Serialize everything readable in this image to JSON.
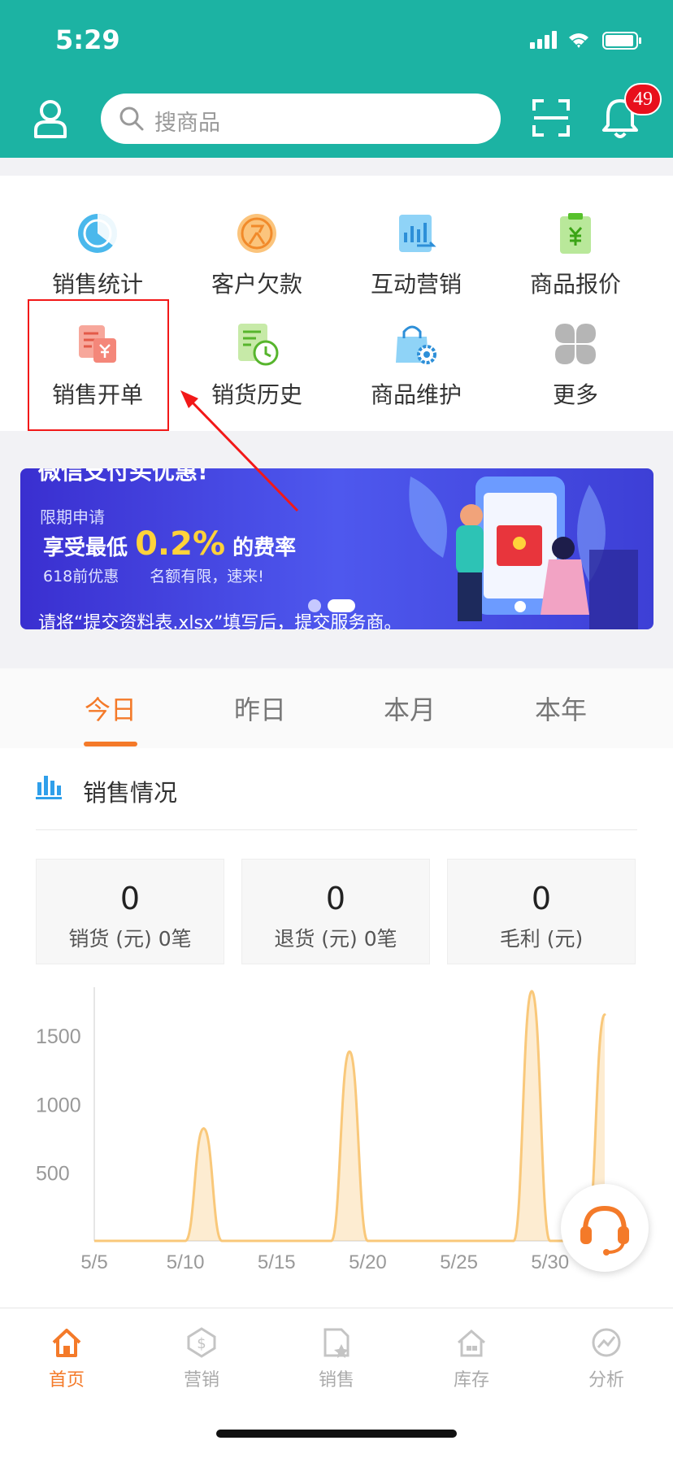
{
  "status_bar": {
    "time": "5:29"
  },
  "header": {
    "search_placeholder": "搜商品",
    "notification_count": "49"
  },
  "menu": {
    "items": [
      {
        "label": "销售统计",
        "icon": "pie-chart-icon"
      },
      {
        "label": "客户欠款",
        "icon": "debt-icon"
      },
      {
        "label": "互动营销",
        "icon": "marketing-icon"
      },
      {
        "label": "商品报价",
        "icon": "price-clipboard-icon"
      },
      {
        "label": "销售开单",
        "icon": "sales-bill-icon"
      },
      {
        "label": "销货历史",
        "icon": "history-icon"
      },
      {
        "label": "商品维护",
        "icon": "bag-gear-icon"
      },
      {
        "label": "更多",
        "icon": "more-grid-icon"
      }
    ]
  },
  "banner": {
    "top_text": "微信支付买优惠!",
    "line1": "限期申请",
    "line2_prefix": "享受最低",
    "line2_highlight": "0.2%",
    "line2_suffix": "的费率",
    "line3": "618前优惠　　名额有限，速来!",
    "line4": "请将“提交资料表.xlsx”填写后，提交服务商。"
  },
  "period_tabs": [
    "今日",
    "昨日",
    "本月",
    "本年"
  ],
  "sales": {
    "title": "销售情况",
    "stats": [
      {
        "value": "0",
        "label": "销货 (元) 0笔"
      },
      {
        "value": "0",
        "label": "退货 (元) 0笔"
      },
      {
        "value": "0",
        "label": "毛利 (元)"
      }
    ]
  },
  "chart_data": {
    "type": "area",
    "x": [
      "5/5",
      "5/6",
      "5/7",
      "5/8",
      "5/9",
      "5/10",
      "5/11",
      "5/12",
      "5/13",
      "5/14",
      "5/15",
      "5/16",
      "5/17",
      "5/18",
      "5/19",
      "5/20",
      "5/21",
      "5/22",
      "5/23",
      "5/24",
      "5/25",
      "5/26",
      "5/27",
      "5/28",
      "5/29",
      "5/30",
      "5/31",
      "6/1",
      "6/2"
    ],
    "values": [
      0,
      0,
      0,
      0,
      0,
      0,
      820,
      0,
      0,
      0,
      0,
      0,
      0,
      0,
      1380,
      0,
      0,
      0,
      0,
      0,
      0,
      0,
      0,
      0,
      1820,
      0,
      0,
      0,
      1650
    ],
    "x_ticks": [
      "5/5",
      "5/10",
      "5/15",
      "5/20",
      "5/25",
      "5/30"
    ],
    "y_ticks": [
      "500",
      "1000",
      "1500"
    ],
    "ylim": [
      0,
      1850
    ],
    "color": "#f9c87a",
    "grid": false
  },
  "tabbar": [
    {
      "label": "首页",
      "icon": "home-icon",
      "active": true
    },
    {
      "label": "营销",
      "icon": "marketing-tab-icon"
    },
    {
      "label": "销售",
      "icon": "sales-tab-icon"
    },
    {
      "label": "库存",
      "icon": "inventory-tab-icon"
    },
    {
      "label": "分析",
      "icon": "analysis-tab-icon"
    }
  ],
  "colors": {
    "brand": "#1cb3a3",
    "accent": "#f47a29",
    "badge": "#e8101c",
    "highlight_box": "#f21818"
  }
}
